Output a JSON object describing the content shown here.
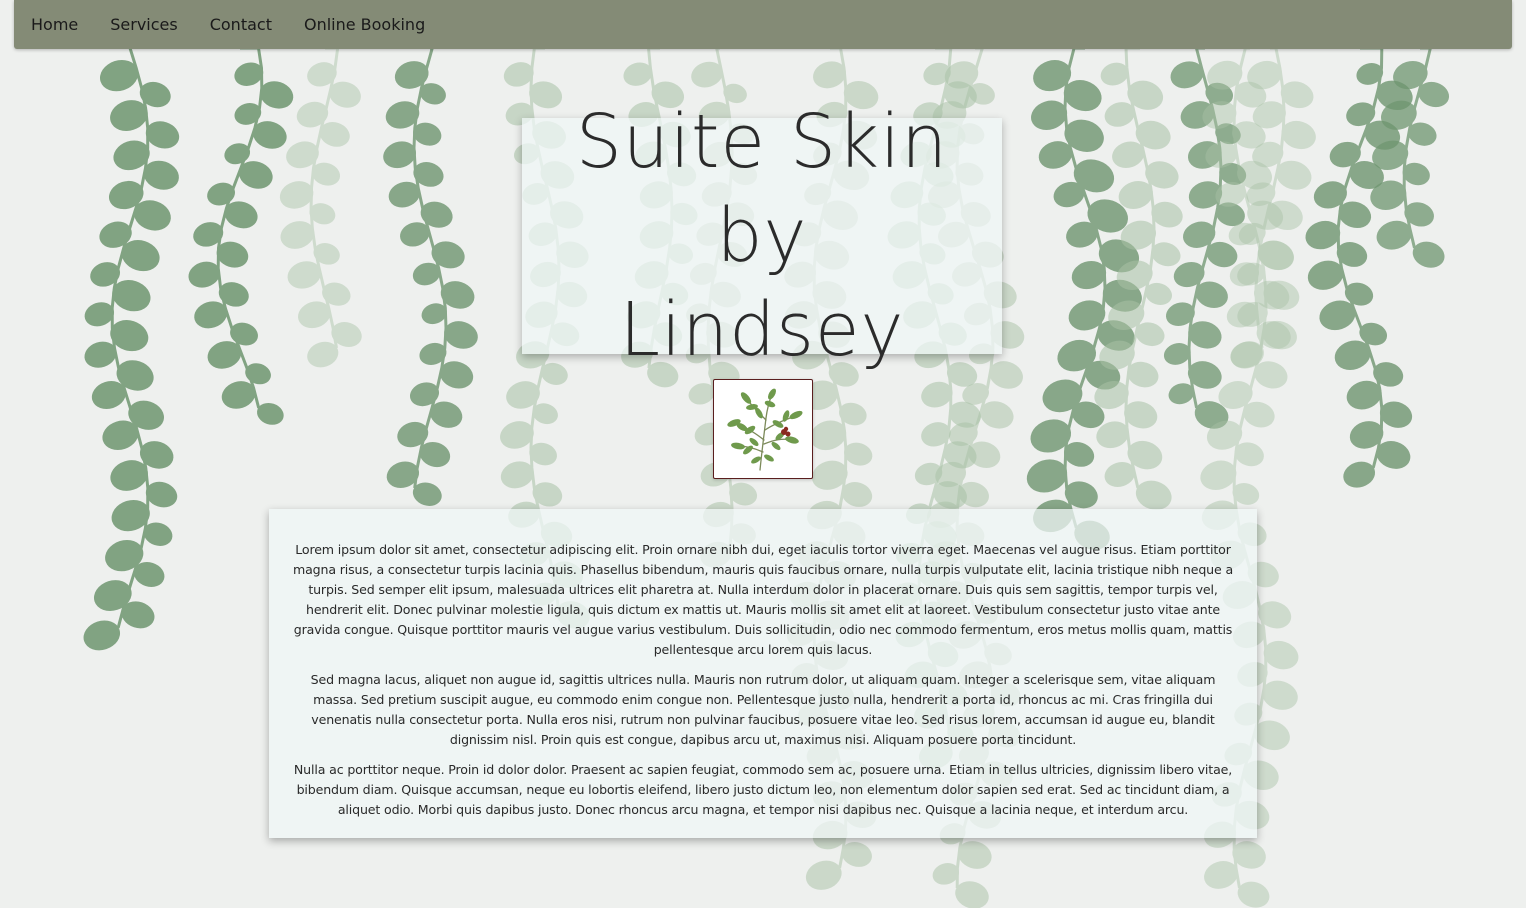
{
  "nav": {
    "items": [
      {
        "label": "Home"
      },
      {
        "label": "Services"
      },
      {
        "label": "Contact"
      },
      {
        "label": "Online Booking"
      }
    ]
  },
  "header": {
    "title_line1": "Suite Skin by",
    "title_line2": "Lindsey"
  },
  "logo": {
    "icon": "green-leaf-sprig-icon"
  },
  "content": {
    "paragraphs": [
      "Lorem ipsum dolor sit amet, consectetur adipiscing elit. Proin ornare nibh dui, eget iaculis tortor viverra eget. Maecenas vel augue risus. Etiam porttitor magna risus, a consectetur turpis lacinia quis. Phasellus bibendum, mauris quis faucibus ornare, nulla turpis vulputate elit, lacinia tristique nibh neque a turpis. Sed semper elit ipsum, malesuada ultrices elit pharetra at. Nulla interdum dolor in placerat ornare. Duis quis sem sagittis, tempor turpis vel, hendrerit elit. Donec pulvinar molestie ligula, quis dictum ex mattis ut. Mauris mollis sit amet elit at laoreet. Vestibulum consectetur justo vitae ante gravida congue. Quisque porttitor mauris vel augue varius vestibulum. Duis sollicitudin, odio nec commodo fermentum, eros metus mollis quam, mattis pellentesque arcu lorem quis lacus.",
      "Sed magna lacus, aliquet non augue id, sagittis ultrices nulla. Mauris non rutrum dolor, ut aliquam quam. Integer a scelerisque sem, vitae aliquam massa. Sed pretium suscipit augue, eu commodo enim congue non. Pellentesque justo nulla, hendrerit a porta id, rhoncus ac mi. Cras fringilla dui venenatis nulla consectetur porta. Nulla eros nisi, rutrum non pulvinar faucibus, posuere vitae leo. Sed risus lorem, accumsan id augue eu, blandit dignissim nisl. Proin quis est congue, dapibus arcu ut, maximus nisi. Aliquam posuere porta tincidunt.",
      "Nulla ac porttitor neque. Proin id dolor dolor. Praesent ac sapien feugiat, commodo sem ac, posuere urna. Etiam in tellus ultricies, dignissim libero vitae, bibendum diam. Quisque accumsan, neque eu lobortis eleifend, libero justo dictum leo, non elementum dolor sapien sed erat. Sed ac tincidunt diam, a aliquet odio. Morbi quis dapibus justo. Donec rhoncus arcu magna, et tempor nisi dapibus nec. Quisque a lacinia neque, et interdum arcu."
    ]
  },
  "colors": {
    "navbar": "#848b76",
    "page_background": "#eef0ee",
    "panel": "#f0f6f6",
    "leaf_dark": "#6f9670",
    "leaf_light": "#a9c2a6",
    "logo_border": "#5a1e1e"
  }
}
